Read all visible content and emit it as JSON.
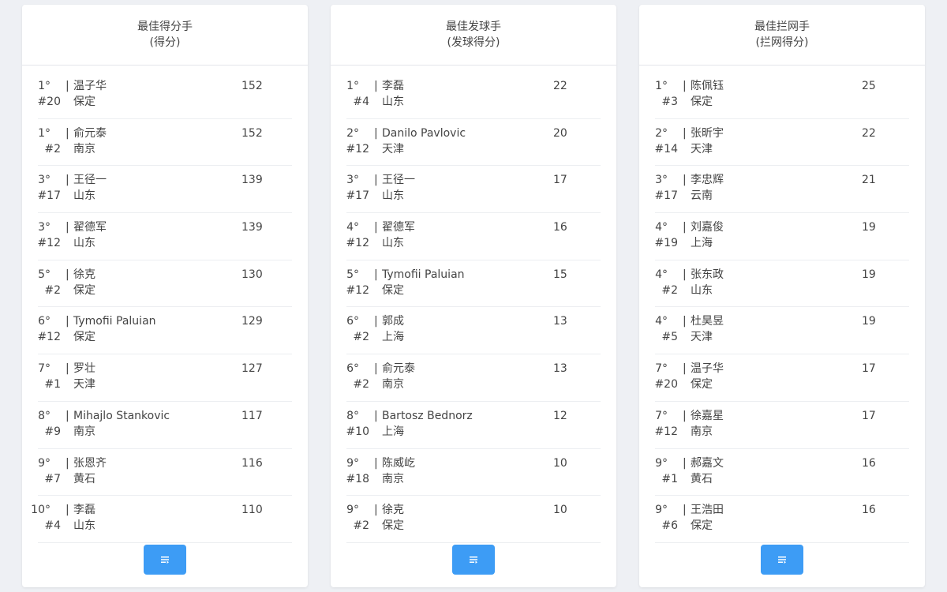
{
  "cards": [
    {
      "title": "最佳得分手",
      "subtitle": "(得分)",
      "rows": [
        {
          "rank": "1°",
          "number": "#20",
          "name": "温子华",
          "team": "保定",
          "score": "152"
        },
        {
          "rank": "1°",
          "number": "#2",
          "name": "俞元泰",
          "team": "南京",
          "score": "152"
        },
        {
          "rank": "3°",
          "number": "#17",
          "name": "王径一",
          "team": "山东",
          "score": "139"
        },
        {
          "rank": "3°",
          "number": "#12",
          "name": "翟德军",
          "team": "山东",
          "score": "139"
        },
        {
          "rank": "5°",
          "number": "#2",
          "name": "徐克",
          "team": "保定",
          "score": "130"
        },
        {
          "rank": "6°",
          "number": "#12",
          "name": "Tymofii Paluian",
          "team": "保定",
          "score": "129"
        },
        {
          "rank": "7°",
          "number": "#1",
          "name": "罗壮",
          "team": "天津",
          "score": "127"
        },
        {
          "rank": "8°",
          "number": "#9",
          "name": "Mihajlo Stankovic",
          "team": "南京",
          "score": "117"
        },
        {
          "rank": "9°",
          "number": "#7",
          "name": "张恩齐",
          "team": "黄石",
          "score": "116"
        },
        {
          "rank": "10°",
          "number": "#4",
          "name": "李磊",
          "team": "山东",
          "score": "110"
        }
      ]
    },
    {
      "title": "最佳发球手",
      "subtitle": "(发球得分)",
      "rows": [
        {
          "rank": "1°",
          "number": "#4",
          "name": "李磊",
          "team": "山东",
          "score": "22"
        },
        {
          "rank": "2°",
          "number": "#12",
          "name": "Danilo Pavlovic",
          "team": "天津",
          "score": "20"
        },
        {
          "rank": "3°",
          "number": "#17",
          "name": "王径一",
          "team": "山东",
          "score": "17"
        },
        {
          "rank": "4°",
          "number": "#12",
          "name": "翟德军",
          "team": "山东",
          "score": "16"
        },
        {
          "rank": "5°",
          "number": "#12",
          "name": "Tymofii Paluian",
          "team": "保定",
          "score": "15"
        },
        {
          "rank": "6°",
          "number": "#2",
          "name": "郭成",
          "team": "上海",
          "score": "13"
        },
        {
          "rank": "6°",
          "number": "#2",
          "name": "俞元泰",
          "team": "南京",
          "score": "13"
        },
        {
          "rank": "8°",
          "number": "#10",
          "name": "Bartosz Bednorz",
          "team": "上海",
          "score": "12"
        },
        {
          "rank": "9°",
          "number": "#18",
          "name": "陈威屹",
          "team": "南京",
          "score": "10"
        },
        {
          "rank": "9°",
          "number": "#2",
          "name": "徐克",
          "team": "保定",
          "score": "10"
        }
      ]
    },
    {
      "title": "最佳拦网手",
      "subtitle": "(拦网得分)",
      "rows": [
        {
          "rank": "1°",
          "number": "#3",
          "name": "陈佩钰",
          "team": "保定",
          "score": "25"
        },
        {
          "rank": "2°",
          "number": "#14",
          "name": "张昕宇",
          "team": "天津",
          "score": "22"
        },
        {
          "rank": "3°",
          "number": "#17",
          "name": "李忠辉",
          "team": "云南",
          "score": "21"
        },
        {
          "rank": "4°",
          "number": "#19",
          "name": "刘嘉俊",
          "team": "上海",
          "score": "19"
        },
        {
          "rank": "4°",
          "number": "#2",
          "name": "张东政",
          "team": "山东",
          "score": "19"
        },
        {
          "rank": "4°",
          "number": "#5",
          "name": "杜昊昱",
          "team": "天津",
          "score": "19"
        },
        {
          "rank": "7°",
          "number": "#20",
          "name": "温子华",
          "team": "保定",
          "score": "17"
        },
        {
          "rank": "7°",
          "number": "#12",
          "name": "徐嘉星",
          "team": "南京",
          "score": "17"
        },
        {
          "rank": "9°",
          "number": "#1",
          "name": "郝嘉文",
          "team": "黄石",
          "score": "16"
        },
        {
          "rank": "9°",
          "number": "#6",
          "name": "王浩田",
          "team": "保定",
          "score": "16"
        }
      ]
    }
  ],
  "separator": "|",
  "more_button_icon": "list-expand-icon",
  "colors": {
    "button": "#3d9cf5",
    "background": "#eef0f4",
    "card": "#ffffff"
  }
}
